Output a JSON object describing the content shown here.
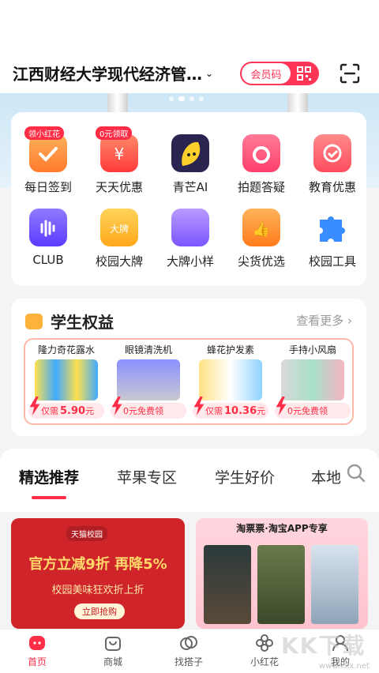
{
  "header": {
    "school_name": "江西财经大学现代经济管…",
    "member_code_label": "会员码"
  },
  "quick_grid": [
    {
      "label": "每日签到",
      "tag": "领小红花",
      "icon": "checkin-icon",
      "color": "#ff8a3d"
    },
    {
      "label": "天天优惠",
      "tag": "0元领取",
      "icon": "coupon-icon",
      "color": "#ff5252"
    },
    {
      "label": "青芒AI",
      "tag": "",
      "icon": "mango-ai-icon",
      "color": "#2a2450"
    },
    {
      "label": "拍题答疑",
      "tag": "",
      "icon": "camera-icon",
      "color": "#ff4f7a"
    },
    {
      "label": "教育优惠",
      "tag": "",
      "icon": "education-icon",
      "color": "#ff4d5e"
    },
    {
      "label": "CLUB",
      "tag": "",
      "icon": "club-icon",
      "color": "#6a4bff"
    },
    {
      "label": "校园大牌",
      "tag": "",
      "icon": "brand-crown-icon",
      "color": "#ffb62e"
    },
    {
      "label": "大牌小样",
      "tag": "",
      "icon": "sample-icon",
      "color": "#8a62ff"
    },
    {
      "label": "尖货优选",
      "tag": "",
      "icon": "thumb-bag-icon",
      "color": "#ff8a2a"
    },
    {
      "label": "校园工具",
      "tag": "",
      "icon": "puzzle-icon",
      "color": "#3a8dff"
    }
  ],
  "benefits": {
    "title": "学生权益",
    "more": "查看更多 ›",
    "products": [
      {
        "name": "隆力奇花露水",
        "price_prefix": "仅需",
        "price": "5.90",
        "price_suffix": "元",
        "highlight": true
      },
      {
        "name": "眼镜清洗机",
        "price_prefix": "",
        "price": "0元免费领",
        "price_suffix": "",
        "highlight": false
      },
      {
        "name": "蜂花护发素",
        "price_prefix": "仅需",
        "price": "10.36",
        "price_suffix": "元",
        "highlight": true
      },
      {
        "name": "手持小风扇",
        "price_prefix": "",
        "price": "0元免费领",
        "price_suffix": "",
        "highlight": false
      }
    ]
  },
  "tabs": [
    "精选推荐",
    "苹果专区",
    "学生好价",
    "本地"
  ],
  "feed": {
    "left": {
      "header": "天猫校园",
      "headline": "官方立减9折 再降5%",
      "sub": "校园美味狂欢折上折",
      "button": "立即抢购"
    },
    "right": {
      "header": "淘票票·淘宝APP专享"
    }
  },
  "bottom_nav": [
    {
      "label": "首页",
      "icon": "home-icon",
      "active": true
    },
    {
      "label": "商城",
      "icon": "shop-bag-icon",
      "active": false
    },
    {
      "label": "找搭子",
      "icon": "partner-icon",
      "active": false
    },
    {
      "label": "小红花",
      "icon": "flower-icon",
      "active": false
    },
    {
      "label": "我的",
      "icon": "profile-icon",
      "active": false
    }
  ],
  "watermark": "KK下载",
  "watermark_url": "www.kkx.net",
  "colors": {
    "accent": "#ff2d46",
    "member": "#ff3558"
  }
}
